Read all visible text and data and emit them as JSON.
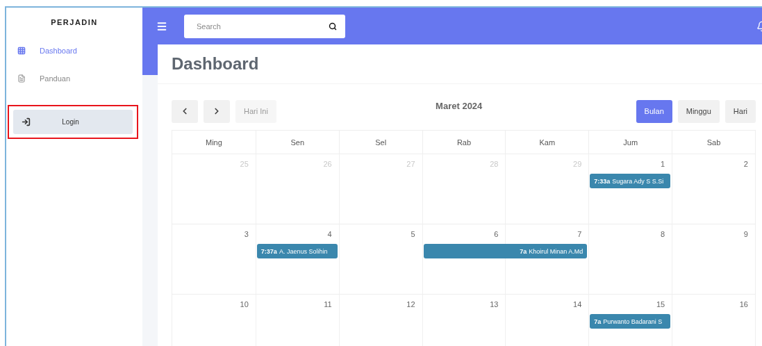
{
  "sidebar": {
    "brand": "PERJADIN",
    "items": [
      {
        "label": "Dashboard",
        "selected": true
      },
      {
        "label": "Panduan",
        "selected": false
      }
    ],
    "login": {
      "label": "Login",
      "highlighted": true
    }
  },
  "topbar": {
    "search": {
      "placeholder": "Search"
    }
  },
  "page": {
    "title": "Dashboard"
  },
  "calendar": {
    "nav": {
      "today": "Hari Ini",
      "today_disabled": true
    },
    "title": "Maret 2024",
    "views": [
      {
        "label": "Bulan",
        "selected": true
      },
      {
        "label": "Minggu",
        "selected": false
      },
      {
        "label": "Hari",
        "selected": false
      }
    ],
    "weekdays": [
      "Ming",
      "Sen",
      "Sel",
      "Rab",
      "Kam",
      "Jum",
      "Sab"
    ],
    "weeks": [
      {
        "days": [
          {
            "date": "25",
            "other_month": true
          },
          {
            "date": "26",
            "other_month": true
          },
          {
            "date": "27",
            "other_month": true
          },
          {
            "date": "28",
            "other_month": true
          },
          {
            "date": "29",
            "other_month": true
          },
          {
            "date": "1",
            "other_month": false,
            "events": [
              {
                "time": "7:33a",
                "title": "Sugara Ady S S.Si",
                "kind": "single"
              }
            ]
          },
          {
            "date": "2",
            "other_month": false
          }
        ]
      },
      {
        "days": [
          {
            "date": "3",
            "other_month": false
          },
          {
            "date": "4",
            "other_month": false,
            "events": [
              {
                "time": "7:37a",
                "title": "A. Jaenus Solihin",
                "kind": "single"
              }
            ]
          },
          {
            "date": "5",
            "other_month": false
          },
          {
            "date": "6",
            "other_month": false,
            "events": [
              {
                "time": "7a",
                "title": "Khoirul Minan A.Md",
                "kind": "multi"
              }
            ]
          },
          {
            "date": "7",
            "other_month": false
          },
          {
            "date": "8",
            "other_month": false
          },
          {
            "date": "9",
            "other_month": false
          }
        ]
      },
      {
        "days": [
          {
            "date": "10",
            "other_month": false
          },
          {
            "date": "11",
            "other_month": false
          },
          {
            "date": "12",
            "other_month": false
          },
          {
            "date": "13",
            "other_month": false
          },
          {
            "date": "14",
            "other_month": false
          },
          {
            "date": "15",
            "other_month": false,
            "events": [
              {
                "time": "7a",
                "title": "Purwanto Badarani S",
                "kind": "single"
              }
            ]
          },
          {
            "date": "16",
            "other_month": false
          }
        ]
      }
    ]
  }
}
